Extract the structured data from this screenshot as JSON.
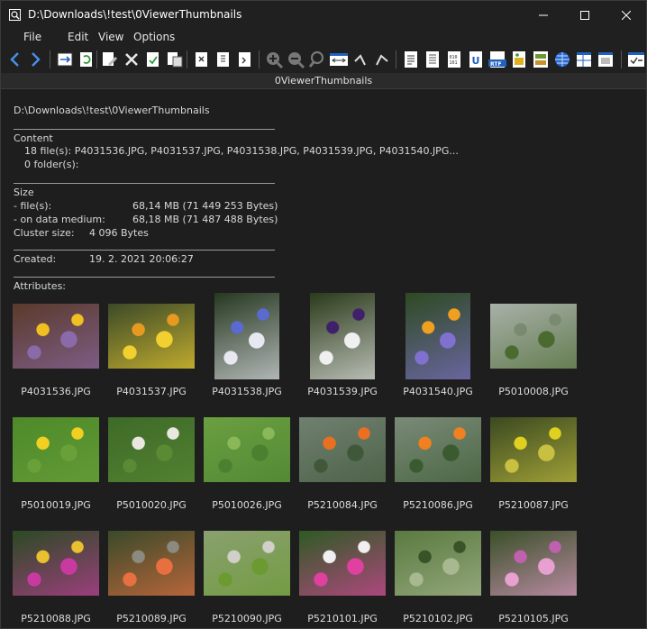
{
  "window": {
    "title": "D:\\Downloads\\!test\\0ViewerThumbnails",
    "controls": {
      "minimize": "—",
      "maximize": "☐",
      "close": "✕"
    }
  },
  "menu": {
    "file": "File",
    "edit": "Edit",
    "view": "View",
    "options": "Options"
  },
  "toolbar": {
    "icons": [
      "back-arrow-icon",
      "forward-arrow-icon",
      "copy-to-clipboard-icon",
      "refresh-icon",
      "edit-icon",
      "delete-icon",
      "select-all-icon",
      "copy-icon",
      "open-icon",
      "paste-icon",
      "new-file-icon",
      "zoom-in-icon",
      "zoom-out-icon",
      "zoom-icon",
      "fit-width-icon",
      "rotate-left-icon",
      "rotate-right-icon",
      "text-file-icon",
      "document-icon",
      "binary-icon",
      "unicode-icon",
      "rtf-icon",
      "image-icon",
      "thumbnails-icon",
      "web-icon",
      "layout-icon",
      "preview-icon",
      "checklist-icon"
    ]
  },
  "path_strip": {
    "label": "0ViewerThumbnails"
  },
  "info": {
    "path": "D:\\Downloads\\!test\\0ViewerThumbnails",
    "content_heading": "Content",
    "files_line": "18 file(s):   P4031536.JPG, P4031537.JPG, P4031538.JPG, P4031539.JPG, P4031540.JPG...",
    "folders_line": "0 folder(s):",
    "size_heading": "Size",
    "files_label": " - file(s):",
    "files_value": "68,14 MB (71 449 253 Bytes)",
    "medium_label": " - on data medium:",
    "medium_value": "68,18 MB (71 487 488 Bytes)",
    "cluster_label": "Cluster size:",
    "cluster_value": "4 096 Bytes",
    "created_label": "Created:",
    "created_value": "19. 2. 2021 20:06:27",
    "attributes_label": "Attributes:"
  },
  "thumbnails": [
    {
      "name": "P4031536.JPG",
      "colors": [
        "#5a3a2a",
        "#8a6aa8",
        "#f0c020"
      ]
    },
    {
      "name": "P4031537.JPG",
      "colors": [
        "#3c4a28",
        "#f2d030",
        "#e89a20"
      ]
    },
    {
      "name": "P4031538.JPG",
      "colors": [
        "#263820",
        "#e8e8f0",
        "#5a6ad0"
      ]
    },
    {
      "name": "P4031539.JPG",
      "colors": [
        "#2a3a1a",
        "#f0f0f0",
        "#40206a"
      ]
    },
    {
      "name": "P4031540.JPG",
      "colors": [
        "#2e4a22",
        "#8070d0",
        "#f0a020"
      ]
    },
    {
      "name": "P5010008.JPG",
      "colors": [
        "#a8b0a8",
        "#4a6a30",
        "#7a8a70"
      ]
    },
    {
      "name": "P5010019.JPG",
      "colors": [
        "#4e8a2a",
        "#6aa03a",
        "#f0d020"
      ]
    },
    {
      "name": "P5010020.JPG",
      "colors": [
        "#3e6a28",
        "#5a8a34",
        "#e8e8e0"
      ]
    },
    {
      "name": "P5010026.JPG",
      "colors": [
        "#6aa040",
        "#4a8030",
        "#8ab858"
      ]
    },
    {
      "name": "P5210084.JPG",
      "colors": [
        "#708070",
        "#40583a",
        "#e87020"
      ]
    },
    {
      "name": "P5210086.JPG",
      "colors": [
        "#7a8a78",
        "#3a5a30",
        "#f08020"
      ]
    },
    {
      "name": "P5210087.JPG",
      "colors": [
        "#3a4a20",
        "#c8c040",
        "#e0d020"
      ]
    },
    {
      "name": "P5210088.JPG",
      "colors": [
        "#2a4a22",
        "#c83aa0",
        "#e8c030"
      ]
    },
    {
      "name": "P5210089.JPG",
      "colors": [
        "#3a4a2a",
        "#e87040",
        "#8a8a80"
      ]
    },
    {
      "name": "P5210090.JPG",
      "colors": [
        "#8aa070",
        "#6a9a30",
        "#d0d0c8"
      ]
    },
    {
      "name": "P5210101.JPG",
      "colors": [
        "#2e5a24",
        "#e040a0",
        "#f0f0f0"
      ]
    },
    {
      "name": "P5210102.JPG",
      "colors": [
        "#5a7a40",
        "#a8b890",
        "#3a5228"
      ]
    },
    {
      "name": "P5210105.JPG",
      "colors": [
        "#3a5028",
        "#e8a0d0",
        "#c060b0"
      ]
    }
  ]
}
